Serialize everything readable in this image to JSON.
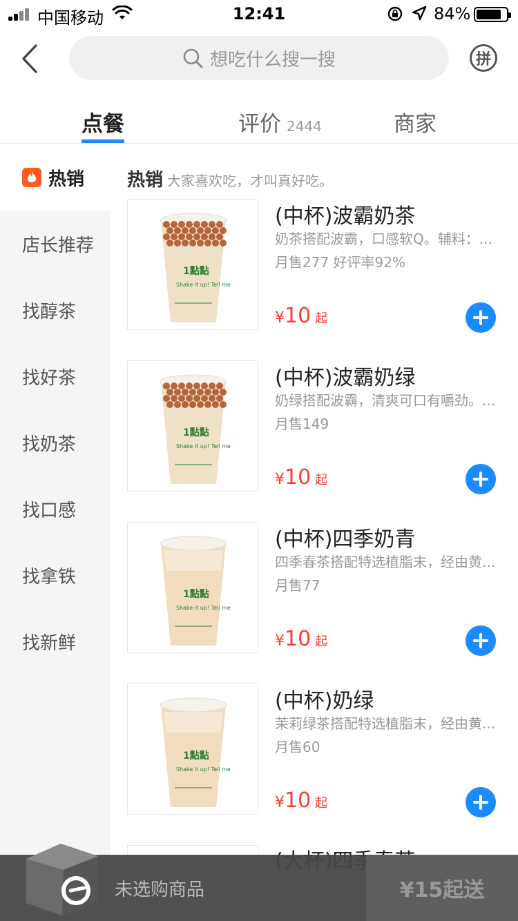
{
  "status_bar": {
    "carrier": "中国移动",
    "time": "12:41",
    "battery": "84%",
    "battery_level": 0.84
  },
  "search": {
    "placeholder": "想吃什么搜一搜"
  },
  "pin_button": {
    "label": "拼"
  },
  "tabs": [
    {
      "label": "点餐",
      "active": true
    },
    {
      "label": "评价",
      "count": "2444"
    },
    {
      "label": "商家"
    }
  ],
  "sidebar": {
    "items": [
      {
        "label": "热销",
        "active": true,
        "icon": "fire-icon"
      },
      {
        "label": "店长推荐"
      },
      {
        "label": "找醇茶"
      },
      {
        "label": "找好茶"
      },
      {
        "label": "找奶茶"
      },
      {
        "label": "找口感"
      },
      {
        "label": "找拿铁"
      },
      {
        "label": "找新鲜"
      }
    ]
  },
  "section": {
    "title": "热销",
    "description": "大家喜欢吃，才叫真好吃。"
  },
  "products": [
    {
      "name": "(中杯)波霸奶茶",
      "desc": "奶茶搭配波霸，口感软Q。辅料：...",
      "sales": "月售277  好评率92%",
      "price_currency": "¥",
      "price": "10",
      "price_suffix": "起",
      "style": "boba"
    },
    {
      "name": "(中杯)波霸奶绿",
      "desc": "奶绿搭配波霸，清爽可口有嚼劲。...",
      "sales": "月售149",
      "price_currency": "¥",
      "price": "10",
      "price_suffix": "起",
      "style": "boba"
    },
    {
      "name": "(中杯)四季奶青",
      "desc": "四季春茶搭配特选植脂末，经由黄...",
      "sales": "月售77",
      "price_currency": "¥",
      "price": "10",
      "price_suffix": "起",
      "style": "plain"
    },
    {
      "name": "(中杯)奶绿",
      "desc": "茉莉绿茶搭配特选植脂末，经由黄...",
      "sales": "月售60",
      "price_currency": "¥",
      "price": "10",
      "price_suffix": "起",
      "style": "plain"
    }
  ],
  "partial_product": {
    "name": "(大杯)四季春茶"
  },
  "cart": {
    "empty_text": "未选购商品",
    "checkout_label": "¥15起送"
  },
  "colors": {
    "accent": "#1a8cff",
    "price": "#ff3b30",
    "fire": "#ff5a1f"
  }
}
